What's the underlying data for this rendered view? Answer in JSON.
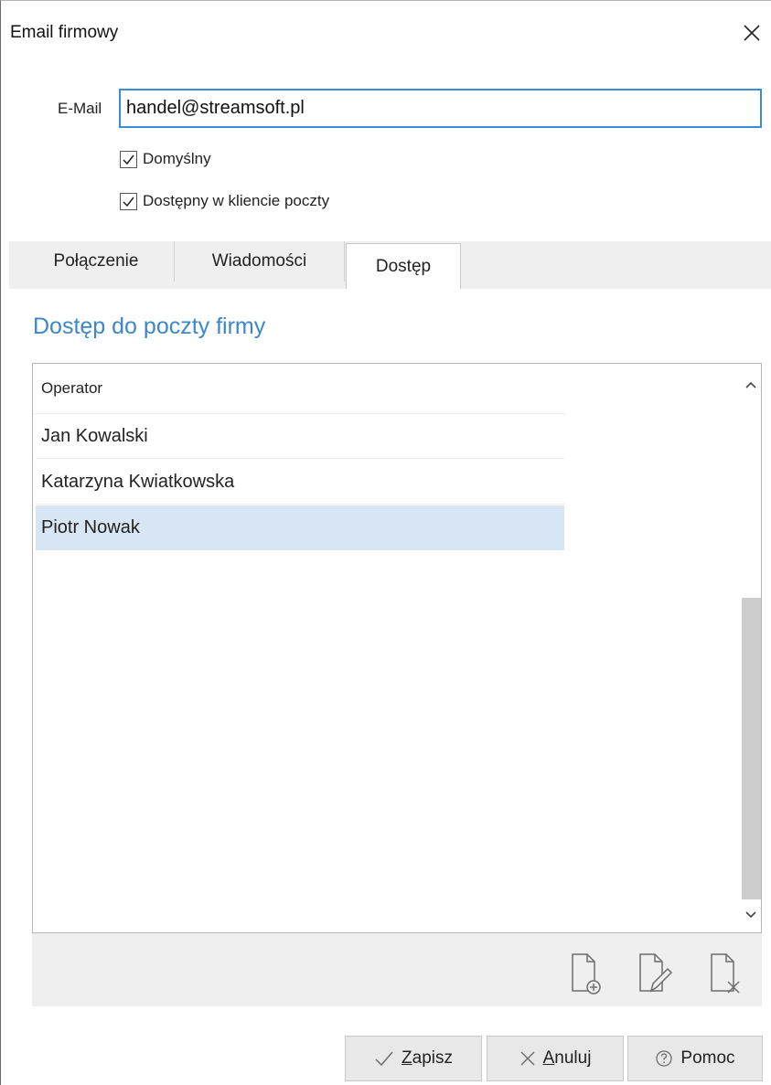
{
  "window": {
    "title": "Email firmowy"
  },
  "email": {
    "label": "E-Mail",
    "value": "handel@streamsoft.pl"
  },
  "checkboxes": [
    {
      "label": "Domyślny",
      "checked": true
    },
    {
      "label": "Dostępny w kliencie poczty",
      "checked": true
    }
  ],
  "tabs": [
    {
      "label": "Połączenie",
      "active": false
    },
    {
      "label": "Wiadomości",
      "active": false
    },
    {
      "label": "Dostęp",
      "active": true
    }
  ],
  "section": {
    "title": "Dostęp do poczty firmy"
  },
  "grid": {
    "column_header": "Operator",
    "rows": [
      "Jan Kowalski",
      "Katarzyna Kwiatkowska",
      "Piotr Nowak"
    ],
    "selected_row": "Piotr Nowak"
  },
  "toolbar_icons": [
    "add-document-icon",
    "edit-document-icon",
    "delete-document-icon"
  ],
  "footer": {
    "save_first": "Z",
    "save_rest": "apisz",
    "cancel_first": "A",
    "cancel_rest": "nuluj",
    "help": "Pomoc"
  },
  "colors": {
    "accent": "#3d87c9",
    "selected_row": "#d8e5f2",
    "input_border": "#3a8ed6"
  }
}
